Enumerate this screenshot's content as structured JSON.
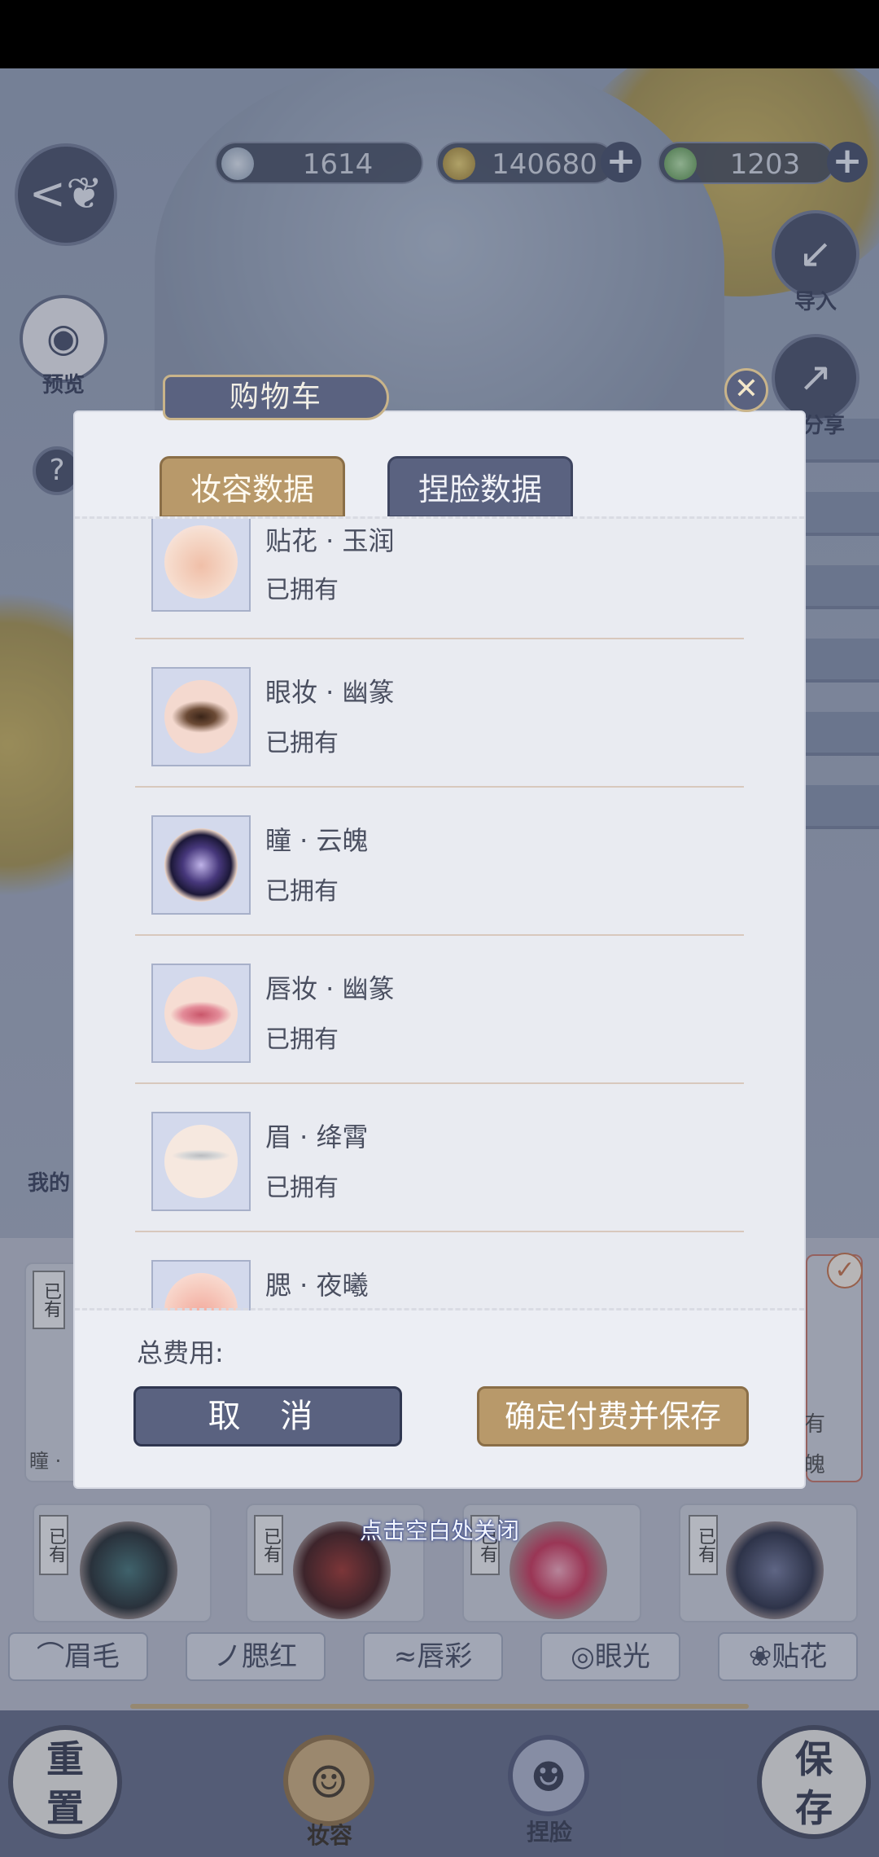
{
  "currency": {
    "jade": "1614",
    "coins": "140680",
    "green": "1203",
    "plus": "+"
  },
  "side": {
    "back_icon": "butterfly-back-icon",
    "preview_label": "预览",
    "help_symbol": "?",
    "import_label": "导入",
    "share_label": "分享",
    "my_label": "我的"
  },
  "modal": {
    "title": "购物车",
    "close_symbol": "✕",
    "tabs": [
      {
        "label": "妆容数据",
        "active": true
      },
      {
        "label": "捏脸数据",
        "active": false
      }
    ],
    "items": [
      {
        "name": "贴花 · 玉润",
        "status": "已拥有",
        "icon": "nose-sticker-icon"
      },
      {
        "name": "眼妆 · 幽篆",
        "status": "已拥有",
        "icon": "eye-makeup-icon"
      },
      {
        "name": "瞳 · 云魄",
        "status": "已拥有",
        "icon": "pupil-icon"
      },
      {
        "name": "唇妆 · 幽篆",
        "status": "已拥有",
        "icon": "lips-icon"
      },
      {
        "name": "眉 · 绛霄",
        "status": "已拥有",
        "icon": "eyebrow-icon"
      },
      {
        "name": "腮 · 夜曦",
        "status": "",
        "icon": "blush-icon"
      }
    ],
    "total_label": "总费用:",
    "cancel_label": "取 消",
    "confirm_label": "确定付费并保存",
    "close_hint": "点击空白处关闭"
  },
  "background": {
    "owned_badge": "已有",
    "card_partial_left": "瞳 ·",
    "card_partial_right_1": "有",
    "card_partial_right_2": "魄",
    "categories": [
      "眉毛",
      "腮红",
      "唇彩",
      "眼光",
      "贴花"
    ],
    "reset_label": "重置",
    "makeup_label": "妆容",
    "face_label": "捏脸",
    "save_label": "保存"
  },
  "colors": {
    "accent_gold": "#b8996a",
    "accent_navy": "#5a6280",
    "modal_bg": "#eceef4"
  }
}
